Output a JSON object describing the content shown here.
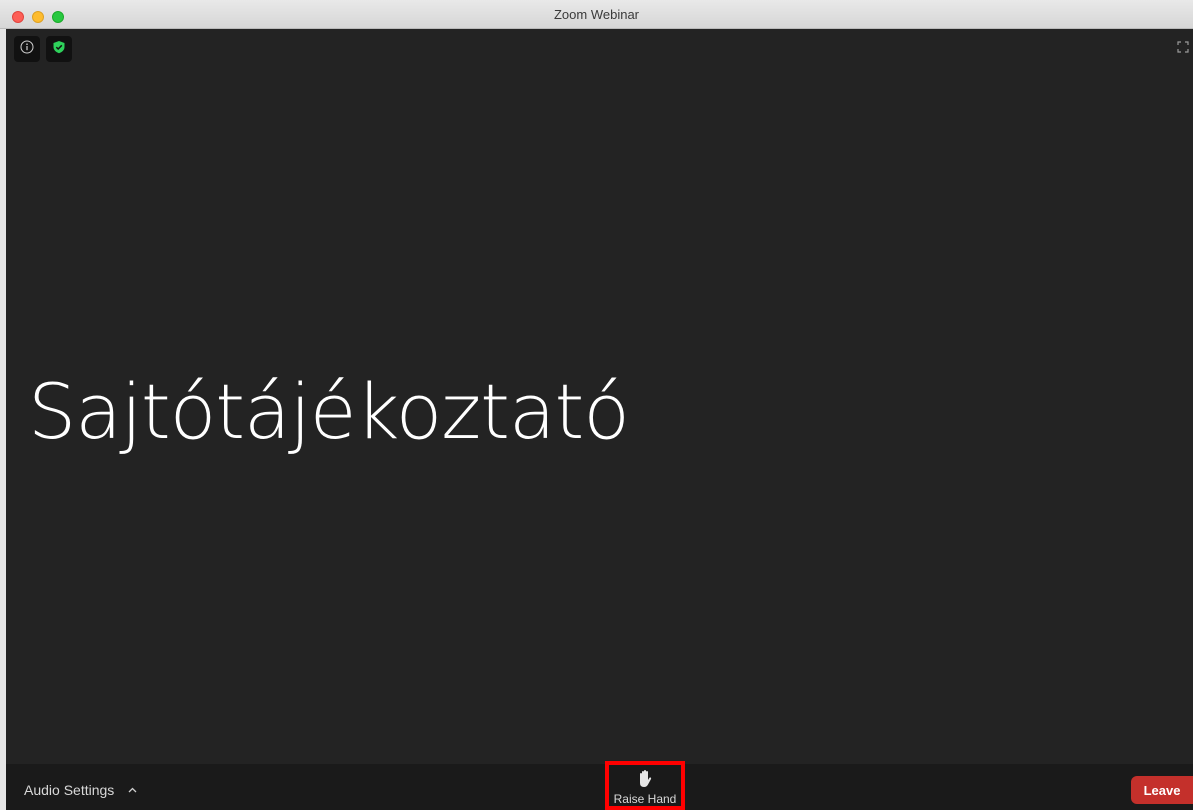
{
  "window": {
    "title": "Zoom Webinar"
  },
  "slide": {
    "text": "Sajtótájékoztató"
  },
  "toolbar": {
    "audio_settings_label": "Audio Settings",
    "raise_hand_label": "Raise Hand",
    "leave_label": "Leave"
  },
  "icons": {
    "info": "info-icon",
    "shield": "shield-check-icon",
    "fullscreen": "fullscreen-icon",
    "chevron": "chevron-up-icon",
    "hand": "hand-icon"
  },
  "colors": {
    "leave": "#c4302b",
    "shield": "#2ed15b",
    "highlight": "#ff0000"
  }
}
